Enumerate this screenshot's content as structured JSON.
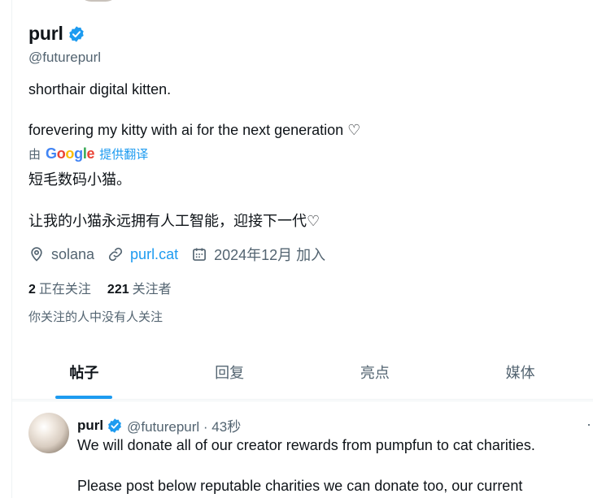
{
  "profile": {
    "display_name": "purl",
    "handle": "@futurepurl",
    "bio_line1": "shorthair digital kitten.",
    "bio_line2": "forevering my kitty with ai for the next generation ♡",
    "translate": {
      "by_label": "由",
      "provider": "Google",
      "link_label": "提供翻译"
    },
    "translation_line1": "短毛数码小猫。",
    "translation_line2": "让我的小猫永远拥有人工智能，迎接下一代♡",
    "location": "solana",
    "website": "purl.cat",
    "joined": "2024年12月 加入",
    "following_count": "2",
    "following_label": "正在关注",
    "followers_count": "221",
    "followers_label": "关注者",
    "followers_note": "你关注的人中没有人关注"
  },
  "tabs": [
    {
      "label": "帖子",
      "active": true
    },
    {
      "label": "回复",
      "active": false
    },
    {
      "label": "亮点",
      "active": false
    },
    {
      "label": "媒体",
      "active": false
    }
  ],
  "post": {
    "author_name": "purl",
    "author_handle": "@futurepurl · 43秒",
    "more": "·",
    "text_line1": "We will donate all of our creator rewards from pumpfun to cat charities.",
    "text_line2": "Please post below reputable charities we can donate too, our current"
  },
  "colors": {
    "accent": "#1d9bf0",
    "text_primary": "#0f1419",
    "text_secondary": "#536471",
    "divider": "#eff3f4"
  },
  "icons": {
    "verified": "verified-badge-icon",
    "location": "location-pin-icon",
    "link": "link-icon",
    "calendar": "calendar-icon"
  }
}
